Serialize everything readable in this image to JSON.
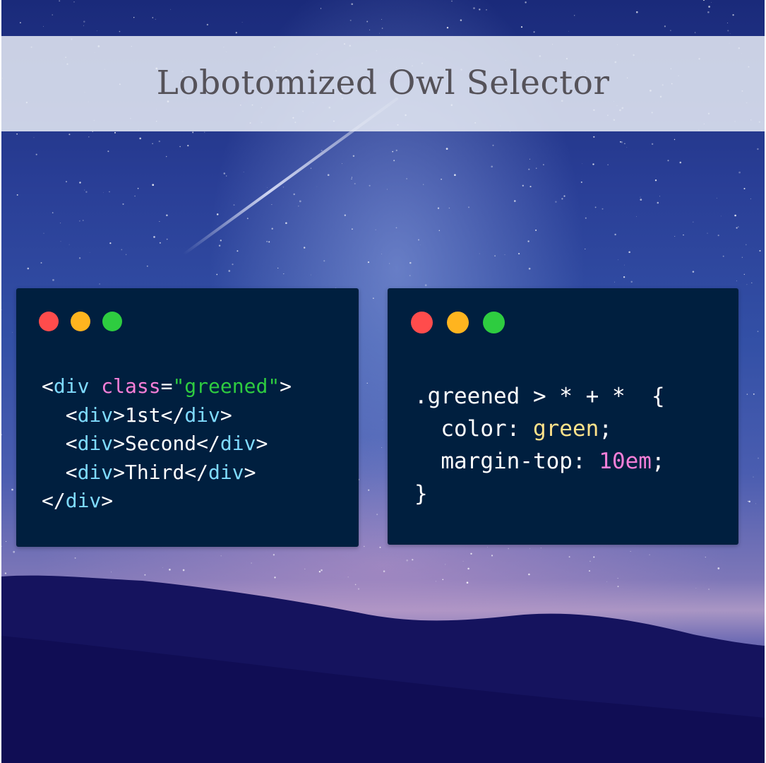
{
  "title": "Lobotomized Owl Selector",
  "colors": {
    "tag": "#7fdbff",
    "attr": "#f77fd8",
    "string": "#2ecc40",
    "text": "#ffffff",
    "value_keyword": "#ffe28a",
    "value_number": "#f77fd8",
    "window_bg": "#001f3f",
    "dot_red": "#ff4136",
    "dot_yellow": "#ffb400",
    "dot_green": "#2ecc40"
  },
  "window_controls": {
    "left": [
      "red-dot",
      "yellow-dot",
      "green-dot"
    ],
    "right": [
      "red-dot",
      "yellow-dot",
      "green-dot"
    ]
  },
  "html_code": {
    "lines": [
      [
        {
          "t": "<",
          "c": "text"
        },
        {
          "t": "div",
          "c": "tag"
        },
        {
          "t": " ",
          "c": "text"
        },
        {
          "t": "class",
          "c": "attr"
        },
        {
          "t": "=",
          "c": "text"
        },
        {
          "t": "\"greened\"",
          "c": "string"
        },
        {
          "t": ">",
          "c": "text"
        }
      ],
      [
        {
          "t": "  <",
          "c": "text"
        },
        {
          "t": "div",
          "c": "tag"
        },
        {
          "t": ">1st</",
          "c": "text"
        },
        {
          "t": "div",
          "c": "tag"
        },
        {
          "t": ">",
          "c": "text"
        }
      ],
      [
        {
          "t": "  <",
          "c": "text"
        },
        {
          "t": "div",
          "c": "tag"
        },
        {
          "t": ">Second</",
          "c": "text"
        },
        {
          "t": "div",
          "c": "tag"
        },
        {
          "t": ">",
          "c": "text"
        }
      ],
      [
        {
          "t": "  <",
          "c": "text"
        },
        {
          "t": "div",
          "c": "tag"
        },
        {
          "t": ">Third</",
          "c": "text"
        },
        {
          "t": "div",
          "c": "tag"
        },
        {
          "t": ">",
          "c": "text"
        }
      ],
      [
        {
          "t": "</",
          "c": "text"
        },
        {
          "t": "div",
          "c": "tag"
        },
        {
          "t": ">",
          "c": "text"
        }
      ]
    ]
  },
  "css_code": {
    "lines": [
      [
        {
          "t": ".greened > * + *  {",
          "c": "text"
        }
      ],
      [
        {
          "t": "  color: ",
          "c": "text"
        },
        {
          "t": "green",
          "c": "value_keyword"
        },
        {
          "t": ";",
          "c": "text"
        }
      ],
      [
        {
          "t": "  margin-top: ",
          "c": "text"
        },
        {
          "t": "10em",
          "c": "value_number"
        },
        {
          "t": ";",
          "c": "text"
        }
      ],
      [
        {
          "t": "}",
          "c": "text"
        }
      ]
    ]
  }
}
